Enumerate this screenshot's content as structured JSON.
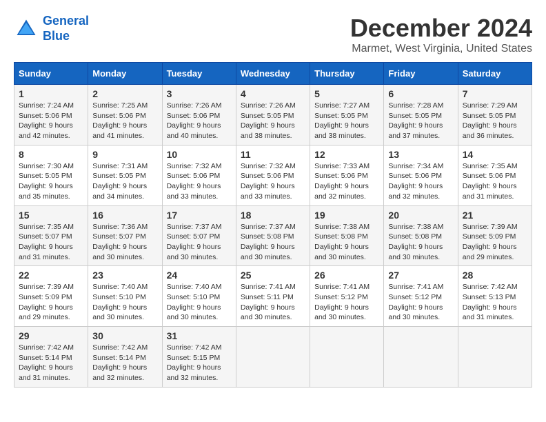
{
  "logo": {
    "line1": "General",
    "line2": "Blue"
  },
  "title": "December 2024",
  "subtitle": "Marmet, West Virginia, United States",
  "headers": [
    "Sunday",
    "Monday",
    "Tuesday",
    "Wednesday",
    "Thursday",
    "Friday",
    "Saturday"
  ],
  "weeks": [
    [
      {
        "day": "1",
        "sunrise": "Sunrise: 7:24 AM",
        "sunset": "Sunset: 5:06 PM",
        "daylight": "Daylight: 9 hours and 42 minutes."
      },
      {
        "day": "2",
        "sunrise": "Sunrise: 7:25 AM",
        "sunset": "Sunset: 5:06 PM",
        "daylight": "Daylight: 9 hours and 41 minutes."
      },
      {
        "day": "3",
        "sunrise": "Sunrise: 7:26 AM",
        "sunset": "Sunset: 5:06 PM",
        "daylight": "Daylight: 9 hours and 40 minutes."
      },
      {
        "day": "4",
        "sunrise": "Sunrise: 7:26 AM",
        "sunset": "Sunset: 5:05 PM",
        "daylight": "Daylight: 9 hours and 38 minutes."
      },
      {
        "day": "5",
        "sunrise": "Sunrise: 7:27 AM",
        "sunset": "Sunset: 5:05 PM",
        "daylight": "Daylight: 9 hours and 38 minutes."
      },
      {
        "day": "6",
        "sunrise": "Sunrise: 7:28 AM",
        "sunset": "Sunset: 5:05 PM",
        "daylight": "Daylight: 9 hours and 37 minutes."
      },
      {
        "day": "7",
        "sunrise": "Sunrise: 7:29 AM",
        "sunset": "Sunset: 5:05 PM",
        "daylight": "Daylight: 9 hours and 36 minutes."
      }
    ],
    [
      {
        "day": "8",
        "sunrise": "Sunrise: 7:30 AM",
        "sunset": "Sunset: 5:05 PM",
        "daylight": "Daylight: 9 hours and 35 minutes."
      },
      {
        "day": "9",
        "sunrise": "Sunrise: 7:31 AM",
        "sunset": "Sunset: 5:05 PM",
        "daylight": "Daylight: 9 hours and 34 minutes."
      },
      {
        "day": "10",
        "sunrise": "Sunrise: 7:32 AM",
        "sunset": "Sunset: 5:06 PM",
        "daylight": "Daylight: 9 hours and 33 minutes."
      },
      {
        "day": "11",
        "sunrise": "Sunrise: 7:32 AM",
        "sunset": "Sunset: 5:06 PM",
        "daylight": "Daylight: 9 hours and 33 minutes."
      },
      {
        "day": "12",
        "sunrise": "Sunrise: 7:33 AM",
        "sunset": "Sunset: 5:06 PM",
        "daylight": "Daylight: 9 hours and 32 minutes."
      },
      {
        "day": "13",
        "sunrise": "Sunrise: 7:34 AM",
        "sunset": "Sunset: 5:06 PM",
        "daylight": "Daylight: 9 hours and 32 minutes."
      },
      {
        "day": "14",
        "sunrise": "Sunrise: 7:35 AM",
        "sunset": "Sunset: 5:06 PM",
        "daylight": "Daylight: 9 hours and 31 minutes."
      }
    ],
    [
      {
        "day": "15",
        "sunrise": "Sunrise: 7:35 AM",
        "sunset": "Sunset: 5:07 PM",
        "daylight": "Daylight: 9 hours and 31 minutes."
      },
      {
        "day": "16",
        "sunrise": "Sunrise: 7:36 AM",
        "sunset": "Sunset: 5:07 PM",
        "daylight": "Daylight: 9 hours and 30 minutes."
      },
      {
        "day": "17",
        "sunrise": "Sunrise: 7:37 AM",
        "sunset": "Sunset: 5:07 PM",
        "daylight": "Daylight: 9 hours and 30 minutes."
      },
      {
        "day": "18",
        "sunrise": "Sunrise: 7:37 AM",
        "sunset": "Sunset: 5:08 PM",
        "daylight": "Daylight: 9 hours and 30 minutes."
      },
      {
        "day": "19",
        "sunrise": "Sunrise: 7:38 AM",
        "sunset": "Sunset: 5:08 PM",
        "daylight": "Daylight: 9 hours and 30 minutes."
      },
      {
        "day": "20",
        "sunrise": "Sunrise: 7:38 AM",
        "sunset": "Sunset: 5:08 PM",
        "daylight": "Daylight: 9 hours and 30 minutes."
      },
      {
        "day": "21",
        "sunrise": "Sunrise: 7:39 AM",
        "sunset": "Sunset: 5:09 PM",
        "daylight": "Daylight: 9 hours and 29 minutes."
      }
    ],
    [
      {
        "day": "22",
        "sunrise": "Sunrise: 7:39 AM",
        "sunset": "Sunset: 5:09 PM",
        "daylight": "Daylight: 9 hours and 29 minutes."
      },
      {
        "day": "23",
        "sunrise": "Sunrise: 7:40 AM",
        "sunset": "Sunset: 5:10 PM",
        "daylight": "Daylight: 9 hours and 30 minutes."
      },
      {
        "day": "24",
        "sunrise": "Sunrise: 7:40 AM",
        "sunset": "Sunset: 5:10 PM",
        "daylight": "Daylight: 9 hours and 30 minutes."
      },
      {
        "day": "25",
        "sunrise": "Sunrise: 7:41 AM",
        "sunset": "Sunset: 5:11 PM",
        "daylight": "Daylight: 9 hours and 30 minutes."
      },
      {
        "day": "26",
        "sunrise": "Sunrise: 7:41 AM",
        "sunset": "Sunset: 5:12 PM",
        "daylight": "Daylight: 9 hours and 30 minutes."
      },
      {
        "day": "27",
        "sunrise": "Sunrise: 7:41 AM",
        "sunset": "Sunset: 5:12 PM",
        "daylight": "Daylight: 9 hours and 30 minutes."
      },
      {
        "day": "28",
        "sunrise": "Sunrise: 7:42 AM",
        "sunset": "Sunset: 5:13 PM",
        "daylight": "Daylight: 9 hours and 31 minutes."
      }
    ],
    [
      {
        "day": "29",
        "sunrise": "Sunrise: 7:42 AM",
        "sunset": "Sunset: 5:14 PM",
        "daylight": "Daylight: 9 hours and 31 minutes."
      },
      {
        "day": "30",
        "sunrise": "Sunrise: 7:42 AM",
        "sunset": "Sunset: 5:14 PM",
        "daylight": "Daylight: 9 hours and 32 minutes."
      },
      {
        "day": "31",
        "sunrise": "Sunrise: 7:42 AM",
        "sunset": "Sunset: 5:15 PM",
        "daylight": "Daylight: 9 hours and 32 minutes."
      },
      null,
      null,
      null,
      null
    ]
  ]
}
